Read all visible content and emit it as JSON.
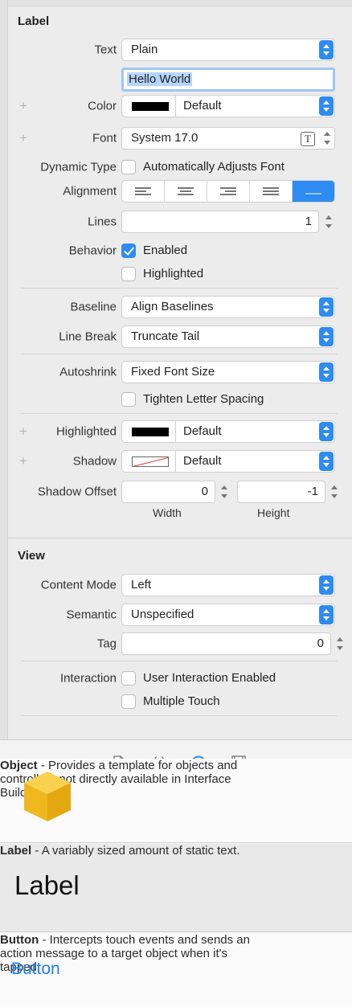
{
  "label_section": {
    "title": "Label",
    "text": {
      "label": "Text",
      "value": "Plain",
      "content": "Hello World"
    },
    "color": {
      "label": "Color",
      "value": "Default"
    },
    "font": {
      "label": "Font",
      "value": "System 17.0",
      "button": "T"
    },
    "dynamic_type": {
      "label": "Dynamic Type",
      "checkbox": "Automatically Adjusts Font",
      "checked": false
    },
    "alignment": {
      "label": "Alignment",
      "selected": 4
    },
    "lines": {
      "label": "Lines",
      "value": "1"
    },
    "behavior": {
      "label": "Behavior",
      "enabled": "Enabled",
      "enabled_checked": true,
      "highlighted": "Highlighted",
      "highlighted_checked": false
    },
    "baseline": {
      "label": "Baseline",
      "value": "Align Baselines"
    },
    "line_break": {
      "label": "Line Break",
      "value": "Truncate Tail"
    },
    "autoshrink": {
      "label": "Autoshrink",
      "value": "Fixed Font Size",
      "tighten": "Tighten Letter Spacing",
      "tighten_checked": false
    },
    "highlighted_color": {
      "label": "Highlighted",
      "value": "Default"
    },
    "shadow": {
      "label": "Shadow",
      "value": "Default"
    },
    "shadow_offset": {
      "label": "Shadow Offset",
      "width": "0",
      "height": "-1",
      "width_label": "Width",
      "height_label": "Height"
    }
  },
  "view_section": {
    "title": "View",
    "content_mode": {
      "label": "Content Mode",
      "value": "Left"
    },
    "semantic": {
      "label": "Semantic",
      "value": "Unspecified"
    },
    "tag": {
      "label": "Tag",
      "value": "0"
    },
    "interaction": {
      "label": "Interaction",
      "user_interaction": "User Interaction Enabled",
      "multiple_touch": "Multiple Touch"
    }
  },
  "library": [
    {
      "name": "Object",
      "description": "Provides a template for objects and controllers not directly available in Interface Builder."
    },
    {
      "name": "Label",
      "preview": "Label",
      "description": "A variably sized amount of static text."
    },
    {
      "name": "Button",
      "preview": "Button",
      "description": "Intercepts touch events and sends an action message to a target object when it's tapped."
    }
  ],
  "colors": {
    "accent": "#2e8bf2",
    "highlight": "#b6d5fb",
    "cube": "#f5c02a"
  },
  "plus_sign": "+",
  "dash": " - "
}
